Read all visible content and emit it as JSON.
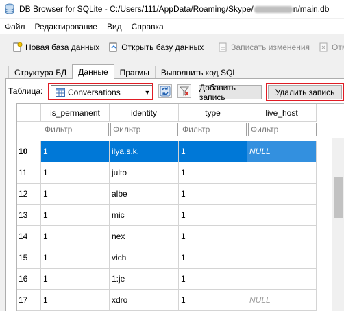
{
  "window": {
    "title_prefix": "DB Browser for SQLite - C:/Users/111/AppData/Roaming/Skype/",
    "title_suffix": "n/main.db"
  },
  "menu": [
    "Файл",
    "Редактирование",
    "Вид",
    "Справка"
  ],
  "toolbar": {
    "new_db": "Новая база данных",
    "open_db": "Открыть базу данных",
    "write_changes": "Записать изменения",
    "revert": "Отм"
  },
  "tabs": [
    "Структура БД",
    "Данные",
    "Прагмы",
    "Выполнить код SQL"
  ],
  "table_bar": {
    "label": "Таблица:",
    "selected_table": "Conversations",
    "add_record": "Добавить запись",
    "delete_record": "Удалить запись"
  },
  "grid": {
    "columns": [
      "is_permanent",
      "identity",
      "type",
      "live_host"
    ],
    "filter_placeholder": "Фильтр",
    "rows": [
      {
        "num": "10",
        "is_permanent": "1",
        "identity": "ilya.s.k.",
        "type": "1",
        "live_host": "NULL",
        "selected": true
      },
      {
        "num": "11",
        "is_permanent": "1",
        "identity": "julto",
        "type": "1",
        "live_host": ""
      },
      {
        "num": "12",
        "is_permanent": "1",
        "identity": "albe",
        "type": "1",
        "live_host": ""
      },
      {
        "num": "13",
        "is_permanent": "1",
        "identity": "mic",
        "type": "1",
        "live_host": ""
      },
      {
        "num": "14",
        "is_permanent": "1",
        "identity": "nex",
        "type": "1",
        "live_host": ""
      },
      {
        "num": "15",
        "is_permanent": "1",
        "identity": "vich",
        "type": "1",
        "live_host": ""
      },
      {
        "num": "16",
        "is_permanent": "1",
        "identity": "1:je",
        "type": "1",
        "live_host": ""
      },
      {
        "num": "17",
        "is_permanent": "1",
        "identity": "xdro",
        "type": "1",
        "live_host": "NULL"
      }
    ]
  },
  "colors": {
    "selection": "#0078d7",
    "highlight_box": "#e01c24"
  }
}
